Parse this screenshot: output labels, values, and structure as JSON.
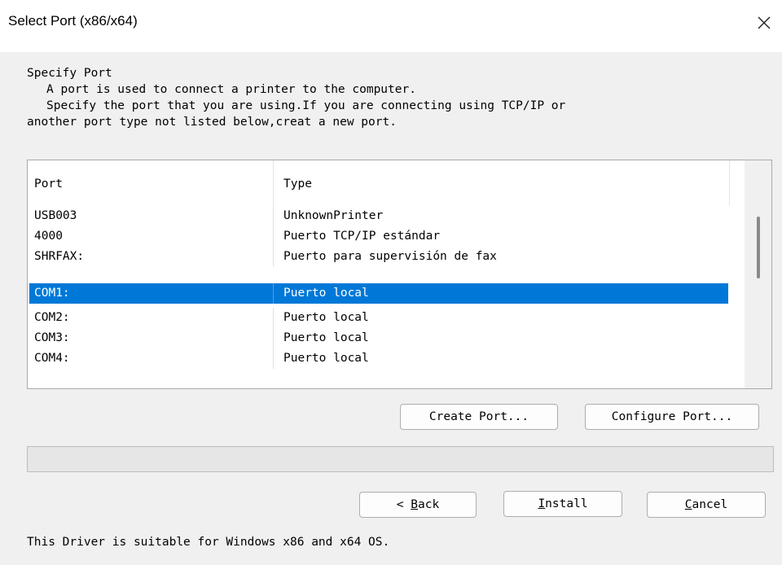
{
  "window": {
    "title": "Select Port (x86/x64)",
    "close_icon": "close-icon"
  },
  "intro": {
    "heading": "Specify Port",
    "line1": "A port is used to connect a printer to the computer.",
    "line2": "Specify the port that you are using.If you are connecting using TCP/IP or",
    "line3": "another port type not listed below,creat a new port."
  },
  "port_list": {
    "columns": [
      "Port",
      "Type"
    ],
    "rows": [
      {
        "port": "USB003",
        "type": "UnknownPrinter",
        "selected": false
      },
      {
        "port": "4000",
        "type": "Puerto TCP/IP estándar",
        "selected": false
      },
      {
        "port": "SHRFAX:",
        "type": "Puerto para supervisión de fax",
        "selected": false
      },
      {
        "port": "COM1:",
        "type": "Puerto local",
        "selected": true
      },
      {
        "port": "COM2:",
        "type": "Puerto local",
        "selected": false
      },
      {
        "port": "COM3:",
        "type": "Puerto local",
        "selected": false
      },
      {
        "port": "COM4:",
        "type": "Puerto local",
        "selected": false
      }
    ],
    "selected_color": "#0078d7"
  },
  "port_buttons": {
    "create": "Create Port...",
    "configure": "Configure Port..."
  },
  "progress": {
    "value_percent": 0
  },
  "nav_buttons": {
    "back_prefix": "< ",
    "back_mnemonic": "B",
    "back_rest": "ack",
    "install_mnemonic": "I",
    "install_rest": "nstall",
    "cancel_mnemonic": "C",
    "cancel_rest": "ancel"
  },
  "footer": {
    "note": "This Driver is suitable for Windows x86 and x64 OS."
  }
}
